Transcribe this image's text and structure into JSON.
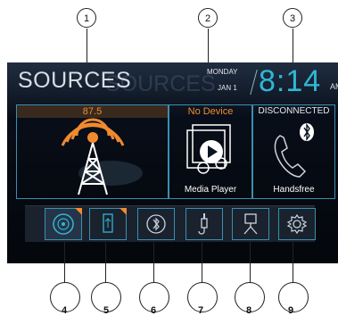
{
  "header": {
    "title": "SOURCES",
    "title_ghost": "SOURCES",
    "day": "MONDAY",
    "date": "JAN 1",
    "time": "8:14",
    "ampm": "AM"
  },
  "panels": [
    {
      "status": "87.5",
      "label": "",
      "icon": "radio-tower-icon"
    },
    {
      "status": "No Device",
      "label": "Media Player",
      "icon": "media-player-icon"
    },
    {
      "status": "DISCONNECTED",
      "label": "Handsfree",
      "icon": "phone-bluetooth-icon"
    }
  ],
  "buttons": [
    {
      "icon": "disc-icon",
      "selected": true,
      "badge": true
    },
    {
      "icon": "usb-icon",
      "selected": false,
      "badge": true
    },
    {
      "icon": "bluetooth-icon",
      "selected": false,
      "badge": false
    },
    {
      "icon": "aux-jack-icon",
      "selected": false,
      "badge": false
    },
    {
      "icon": "ipod-icon",
      "selected": false,
      "badge": false
    },
    {
      "icon": "settings-gear-icon",
      "selected": false,
      "badge": false
    }
  ],
  "callouts": [
    "1",
    "2",
    "3",
    "4",
    "5",
    "6",
    "7",
    "8",
    "9"
  ],
  "colors": {
    "accent": "#2fb7d6",
    "orange": "#f08a30",
    "frame": "#3a8fb0"
  }
}
